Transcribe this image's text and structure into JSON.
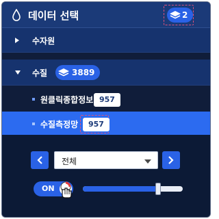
{
  "header": {
    "title": "데이터 선택",
    "layer_count": "2"
  },
  "tree": {
    "items": [
      {
        "label": "수자원",
        "expanded": false
      },
      {
        "label": "수질",
        "expanded": true,
        "count": "3889",
        "children": [
          {
            "label": "원클릭종합정보",
            "count": "957",
            "active": false
          },
          {
            "label": "수질측정망",
            "count": "957",
            "active": true
          }
        ]
      }
    ]
  },
  "controls": {
    "select_value": "전체",
    "toggle_label": "ON",
    "opacity_level": 0.75
  },
  "icons": {
    "header": "water-drop-icon",
    "layers": "layers-icon",
    "prev": "chevron-left-icon",
    "next": "chevron-right-icon",
    "dropdown": "triangle-down-icon",
    "pointer": "hand-pointer-icon"
  },
  "colors": {
    "panel": "#101d3a",
    "header": "#1b3a78",
    "accent": "#2a62e6",
    "active_row": "#2c6bf0"
  }
}
